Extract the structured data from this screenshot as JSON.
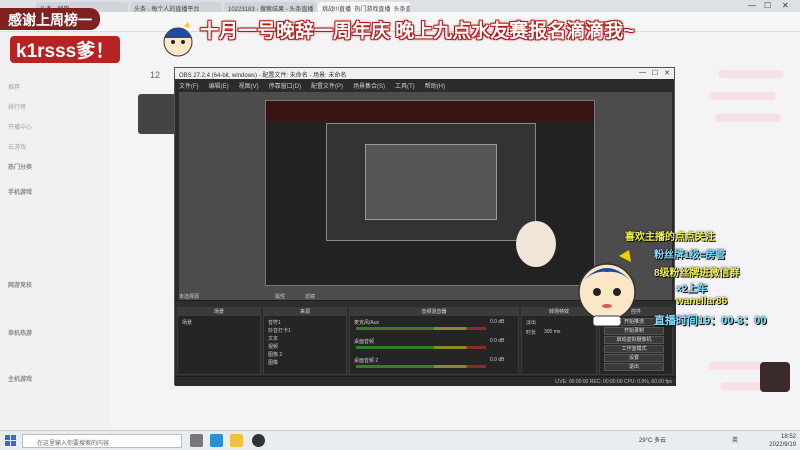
{
  "browser": {
    "tabs": [
      "头条 - 搜狗",
      "头条 - 每个人的直播平台",
      "10223183 - 搜索结果 - 头条直播",
      "挑战!!!直播_热门游戏直播_头条直播"
    ],
    "sidebar": {
      "nav": [
        "推荐",
        "排行榜",
        "开播中心",
        "云游戏"
      ],
      "sections": [
        "热门分类",
        "手机游戏",
        "网游竞技",
        "单机热游",
        "主机游戏"
      ],
      "avatar_count": "12"
    }
  },
  "overlays": {
    "top_left": "感谢上周榜一",
    "scroll_text": "十月一号晚辞一周年庆 晚上九点水友赛报名滴滴我~",
    "name": "k1rsss爹！",
    "right": {
      "line1": "喜欢主播的点点关注",
      "line2": "粉丝牌1级=房管",
      "line3": "8级粉丝牌进微信群",
      "line4": "×2上车",
      "line5": "wanellar86",
      "line6": "直播时间19：00-3：00"
    }
  },
  "obs": {
    "title": "OBS 27.2.4 (64-bit, windows) - 配置文件: 未命名 - 场景: 未命名",
    "menu": [
      "文件(F)",
      "编辑(E)",
      "视图(V)",
      "停靠窗口(D)",
      "配置文件(P)",
      "场景集合(S)",
      "工具(T)",
      "帮助(H)"
    ],
    "no_source": "未选择源",
    "props_btn": "属性",
    "filters_btn": "滤镜",
    "docks": {
      "scenes": {
        "title": "场景",
        "items": [
          "场景"
        ]
      },
      "sources": {
        "title": "来源",
        "items": [
          "音符1",
          "抖音打卡1",
          "文本",
          "视频",
          "图像 2",
          "图像"
        ]
      },
      "mixer": {
        "title": "音频混音器",
        "channels": [
          {
            "name": "麦克风/Aux",
            "db": "0.0 dB"
          },
          {
            "name": "桌面音频",
            "db": "0.0 dB"
          },
          {
            "name": "桌面音频 2",
            "db": "0.0 dB"
          }
        ]
      },
      "transition": {
        "title": "转场特效",
        "mode": "淡出",
        "duration_label": "时长",
        "duration": "300 ms"
      },
      "controls": {
        "title": "控件",
        "buttons": [
          "开始推流",
          "开始录制",
          "启动虚拟摄像机",
          "工作室模式",
          "设置",
          "退出"
        ]
      }
    },
    "status": "LIVE: 00:00:00   REC: 00:00:00   CPU: 0.9%, 60.00 fps"
  },
  "taskbar": {
    "search_placeholder": "在这里输入你要搜索的内容",
    "weather": "29°C 多云",
    "time": "18:52",
    "date": "2022/9/19",
    "ime": "英"
  },
  "colors": {
    "obs_bg": "#2b2b2b",
    "overlay_red": "#b62323",
    "right_text_primary": "#f2f44a",
    "right_text_secondary": "#7ee0ff"
  }
}
